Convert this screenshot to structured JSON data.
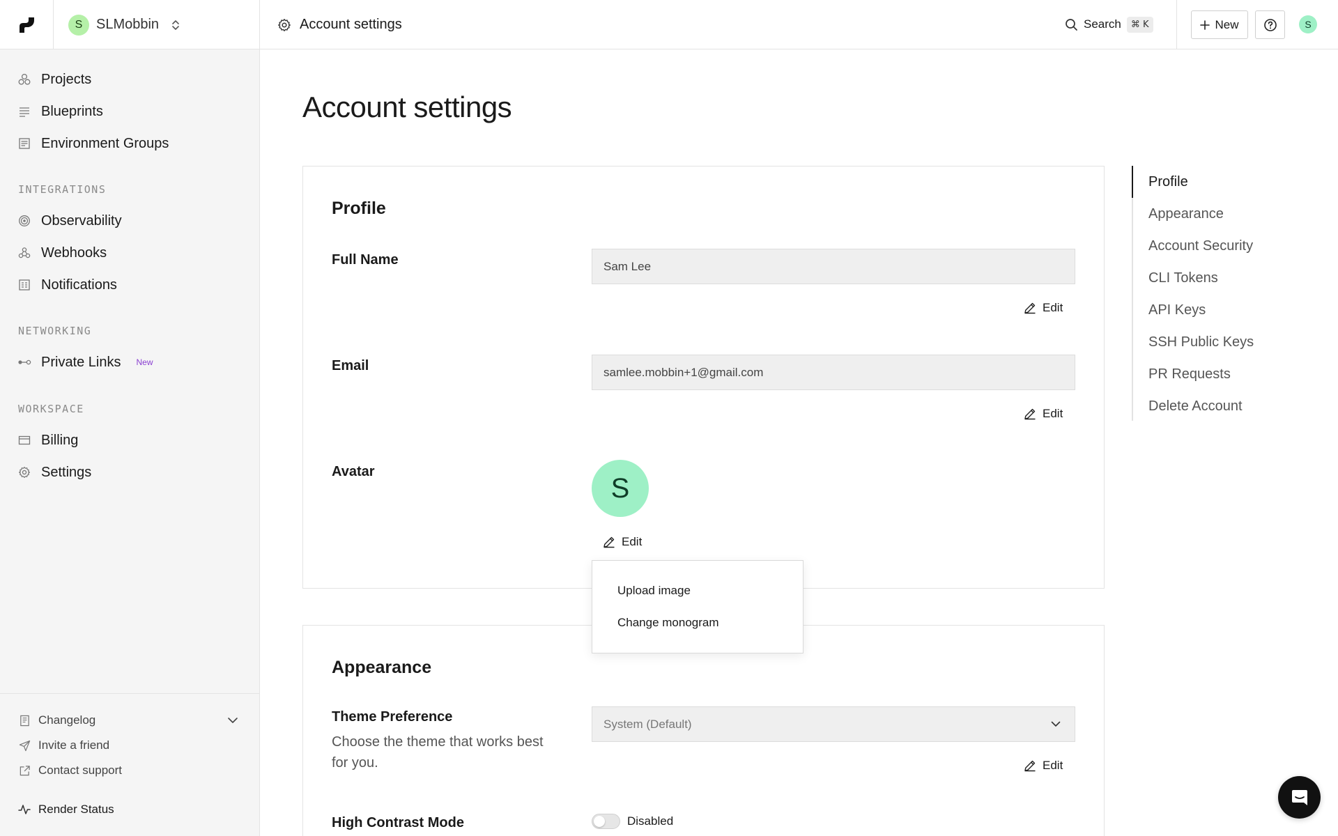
{
  "topbar": {
    "workspace_initial": "S",
    "workspace_name": "SLMobbin",
    "breadcrumb": "Account settings",
    "search_label": "Search",
    "search_shortcut": "⌘ K",
    "new_label": "New",
    "user_initial": "S"
  },
  "sidebar": {
    "main_items": [
      {
        "label": "Projects",
        "icon": "projects-icon"
      },
      {
        "label": "Blueprints",
        "icon": "blueprints-icon"
      },
      {
        "label": "Environment Groups",
        "icon": "environment-groups-icon"
      }
    ],
    "integrations_title": "INTEGRATIONS",
    "integrations": [
      {
        "label": "Observability",
        "icon": "observability-icon"
      },
      {
        "label": "Webhooks",
        "icon": "webhooks-icon"
      },
      {
        "label": "Notifications",
        "icon": "notifications-icon"
      }
    ],
    "networking_title": "NETWORKING",
    "networking": [
      {
        "label": "Private Links",
        "badge": "New",
        "icon": "private-links-icon"
      }
    ],
    "workspace_title": "WORKSPACE",
    "workspace": [
      {
        "label": "Billing",
        "icon": "billing-icon"
      },
      {
        "label": "Settings",
        "icon": "settings-icon"
      }
    ],
    "footer": [
      {
        "label": "Changelog",
        "icon": "changelog-icon"
      },
      {
        "label": "Invite a friend",
        "icon": "send-icon"
      },
      {
        "label": "Contact support",
        "icon": "external-link-icon"
      }
    ],
    "status_label": "Render Status"
  },
  "main": {
    "title": "Account settings",
    "profile": {
      "title": "Profile",
      "full_name_label": "Full Name",
      "full_name_value": "Sam Lee",
      "email_label": "Email",
      "email_value": "samlee.mobbin+1@gmail.com",
      "avatar_label": "Avatar",
      "avatar_initial": "S",
      "edit_label": "Edit"
    },
    "avatar_menu": {
      "upload": "Upload image",
      "monogram": "Change monogram"
    },
    "appearance": {
      "title": "Appearance",
      "theme_label": "Theme Preference",
      "theme_desc": "Choose the theme that works best for you.",
      "theme_value": "System (Default)",
      "edit_label": "Edit",
      "contrast_label": "High Contrast Mode",
      "contrast_value": "Disabled"
    }
  },
  "toc": {
    "items": [
      "Profile",
      "Appearance",
      "Account Security",
      "CLI Tokens",
      "API Keys",
      "SSH Public Keys",
      "PR Requests",
      "Delete Account"
    ],
    "active": "Profile"
  },
  "colors": {
    "workspace_avatar": "#b5f0a8",
    "user_avatar": "#9ef0c6",
    "new_badge": "#8a3fd1",
    "sidebar_bg": "#f5f5f5"
  }
}
